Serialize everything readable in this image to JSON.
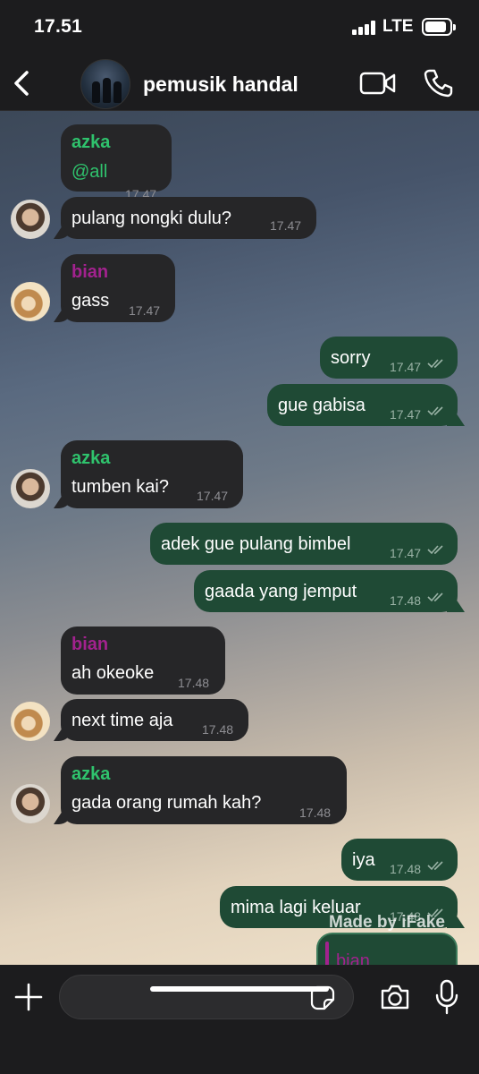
{
  "status": {
    "time": "17.51",
    "network": "LTE"
  },
  "header": {
    "title": "pemusik handal"
  },
  "messages": [
    {
      "sender": "azka",
      "text": "@all",
      "time": "17.47"
    },
    {
      "text": "pulang nongki dulu?",
      "time": "17.47"
    },
    {
      "sender": "bian",
      "text": "gass",
      "time": "17.47"
    },
    {
      "text": "sorry",
      "time": "17.47"
    },
    {
      "text": "gue gabisa",
      "time": "17.47"
    },
    {
      "sender": "azka",
      "text": "tumben kai?",
      "time": "17.47"
    },
    {
      "text": "adek gue pulang bimbel",
      "time": "17.47"
    },
    {
      "text": "gaada yang jemput",
      "time": "17.48"
    },
    {
      "sender": "bian",
      "text": "ah okeoke",
      "time": "17.48"
    },
    {
      "text": "next time aja",
      "time": "17.48"
    },
    {
      "sender": "azka",
      "text": "gada orang rumah kah?",
      "time": "17.48"
    },
    {
      "text": "iya",
      "time": "17.48"
    },
    {
      "text": "mima lagi keluar",
      "time": "17.48"
    }
  ],
  "reply_preview": {
    "sender": "bian"
  },
  "watermark": "Made by iFake",
  "input": {
    "placeholder": ""
  },
  "colors": {
    "incoming_bubble": "#262628",
    "outgoing_bubble": "#1f4a35",
    "azka": "#2fc36d",
    "bian": "#a2228e"
  },
  "icons": [
    "back-icon",
    "video-icon",
    "phone-icon",
    "plus-icon",
    "sticker-icon",
    "camera-icon",
    "mic-icon",
    "read-ticks-icon"
  ]
}
